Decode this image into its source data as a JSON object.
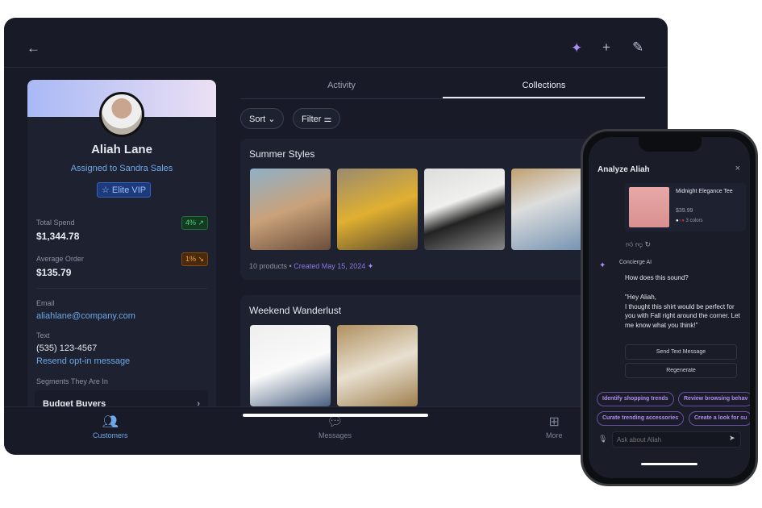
{
  "tablet": {
    "header": {
      "back_icon": "arrow-left",
      "sparkle_icon": "sparkle",
      "add_icon": "plus",
      "edit_icon": "pencil"
    },
    "profile": {
      "name": "Aliah Lane",
      "assigned": "Assigned to Sandra Sales",
      "tier": "☆ Elite VIP",
      "total_spend_label": "Total Spend",
      "total_spend": "$1,344.78",
      "total_spend_change": "4% ↗",
      "avg_order_label": "Average Order",
      "avg_order": "$135.79",
      "avg_order_change": "1% ↘",
      "email_label": "Email",
      "email": "aliahlane@company.com",
      "text_label": "Text",
      "phone": "(535) 123-4567",
      "resend": "Resend opt-in message",
      "segments_label": "Segments They Are In",
      "segment": "Budget Buyers"
    },
    "tabs": [
      "Activity",
      "Collections"
    ],
    "sort": "Sort",
    "filter": "Filter",
    "collections": [
      {
        "title": "Summer Styles",
        "count": "10 products •",
        "created": "Created May 15, 2024"
      },
      {
        "title": "Weekend Wanderlust"
      }
    ],
    "nav": [
      "Customers",
      "Messages",
      "More"
    ],
    "colors": {
      "accent": "#6fa8e8",
      "up": "#4bd37b",
      "down": "#f0a030"
    }
  },
  "phone": {
    "title": "Analyze Aliah",
    "product": {
      "name": "Midnight Elegance Tee",
      "price": "$39.99",
      "colors": "3 colors"
    },
    "sender": "Concierge AI",
    "question": "How does this sound?",
    "message": "\"Hey Aliah,\nI thought this shirt would be perfect for you with Fall right around the corner. Let me know what you think!\"",
    "send": "Send Text Message",
    "regenerate": "Regenerate",
    "chips": [
      "Identify shopping trends",
      "Review browsing behav",
      "Curate trending accessories",
      "Create a look for su"
    ],
    "placeholder": "Ask about Aliah"
  }
}
